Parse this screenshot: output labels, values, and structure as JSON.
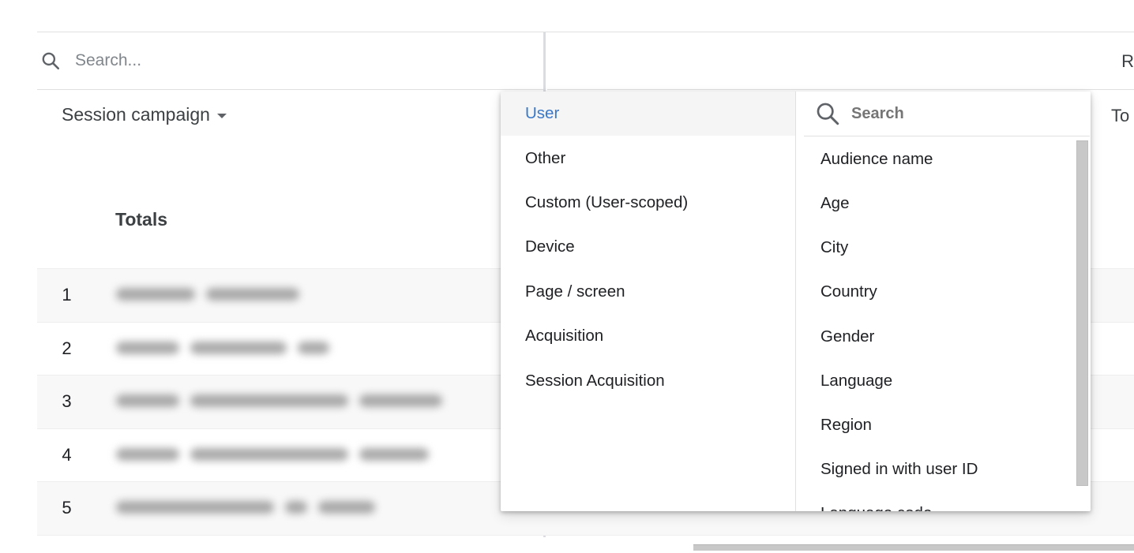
{
  "search": {
    "placeholder": "Search..."
  },
  "right_header": {
    "label": "R"
  },
  "table": {
    "dimension_header": "Session campaign",
    "totals_label": "Totals",
    "metric_header_partial": "To",
    "rows": [
      {
        "index": "1",
        "label": "[redacted]"
      },
      {
        "index": "2",
        "label": "[redacted]"
      },
      {
        "index": "3",
        "label": "[redacted]"
      },
      {
        "index": "4",
        "label": "[redacted]"
      },
      {
        "index": "5",
        "label": "[redacted]"
      }
    ]
  },
  "dropdown": {
    "categories": [
      {
        "label": "User",
        "active": true
      },
      {
        "label": "Other"
      },
      {
        "label": "Custom (User-scoped)"
      },
      {
        "label": "Device"
      },
      {
        "label": "Page / screen"
      },
      {
        "label": "Acquisition"
      },
      {
        "label": "Session Acquisition"
      }
    ],
    "search_placeholder": "Search",
    "items": [
      "Audience name",
      "Age",
      "City",
      "Country",
      "Gender",
      "Language",
      "Region",
      "Signed in with user ID",
      "Language code"
    ]
  },
  "colors": {
    "accent": "#1a73e8",
    "active_bg": "#f5f5f5",
    "text": "#202124",
    "divider": "#e0e0e0"
  }
}
